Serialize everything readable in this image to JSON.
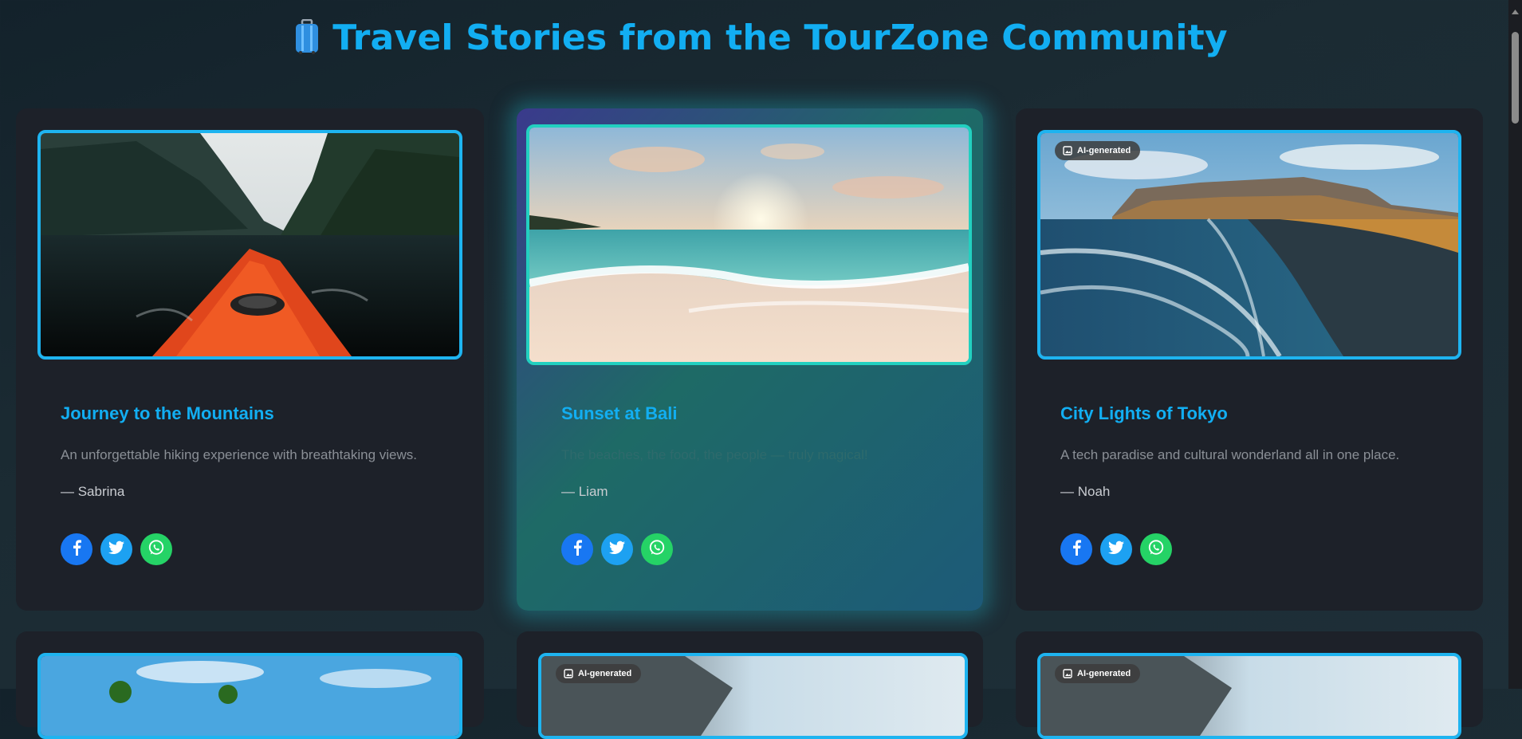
{
  "header": {
    "title": "Travel Stories from the TourZone Community",
    "icon": "luggage-icon"
  },
  "colors": {
    "accent": "#12aef2",
    "card_bg": "#1d2129",
    "facebook": "#1877f2",
    "twitter": "#1da1f2",
    "whatsapp": "#25d366"
  },
  "badge": {
    "label": "AI-generated"
  },
  "stories": [
    {
      "title": "Journey to the Mountains",
      "description": "An unforgettable hiking experience with breathtaking views.",
      "author": "— Sabrina"
    },
    {
      "title": "Sunset at Bali",
      "description": "The beaches, the food, the people — truly magical!",
      "author": "— Liam"
    },
    {
      "title": "City Lights of Tokyo",
      "description": "A tech paradise and cultural wonderland all in one place.",
      "author": "— Noah"
    }
  ],
  "share_icons": [
    "facebook-icon",
    "twitter-icon",
    "whatsapp-icon"
  ]
}
